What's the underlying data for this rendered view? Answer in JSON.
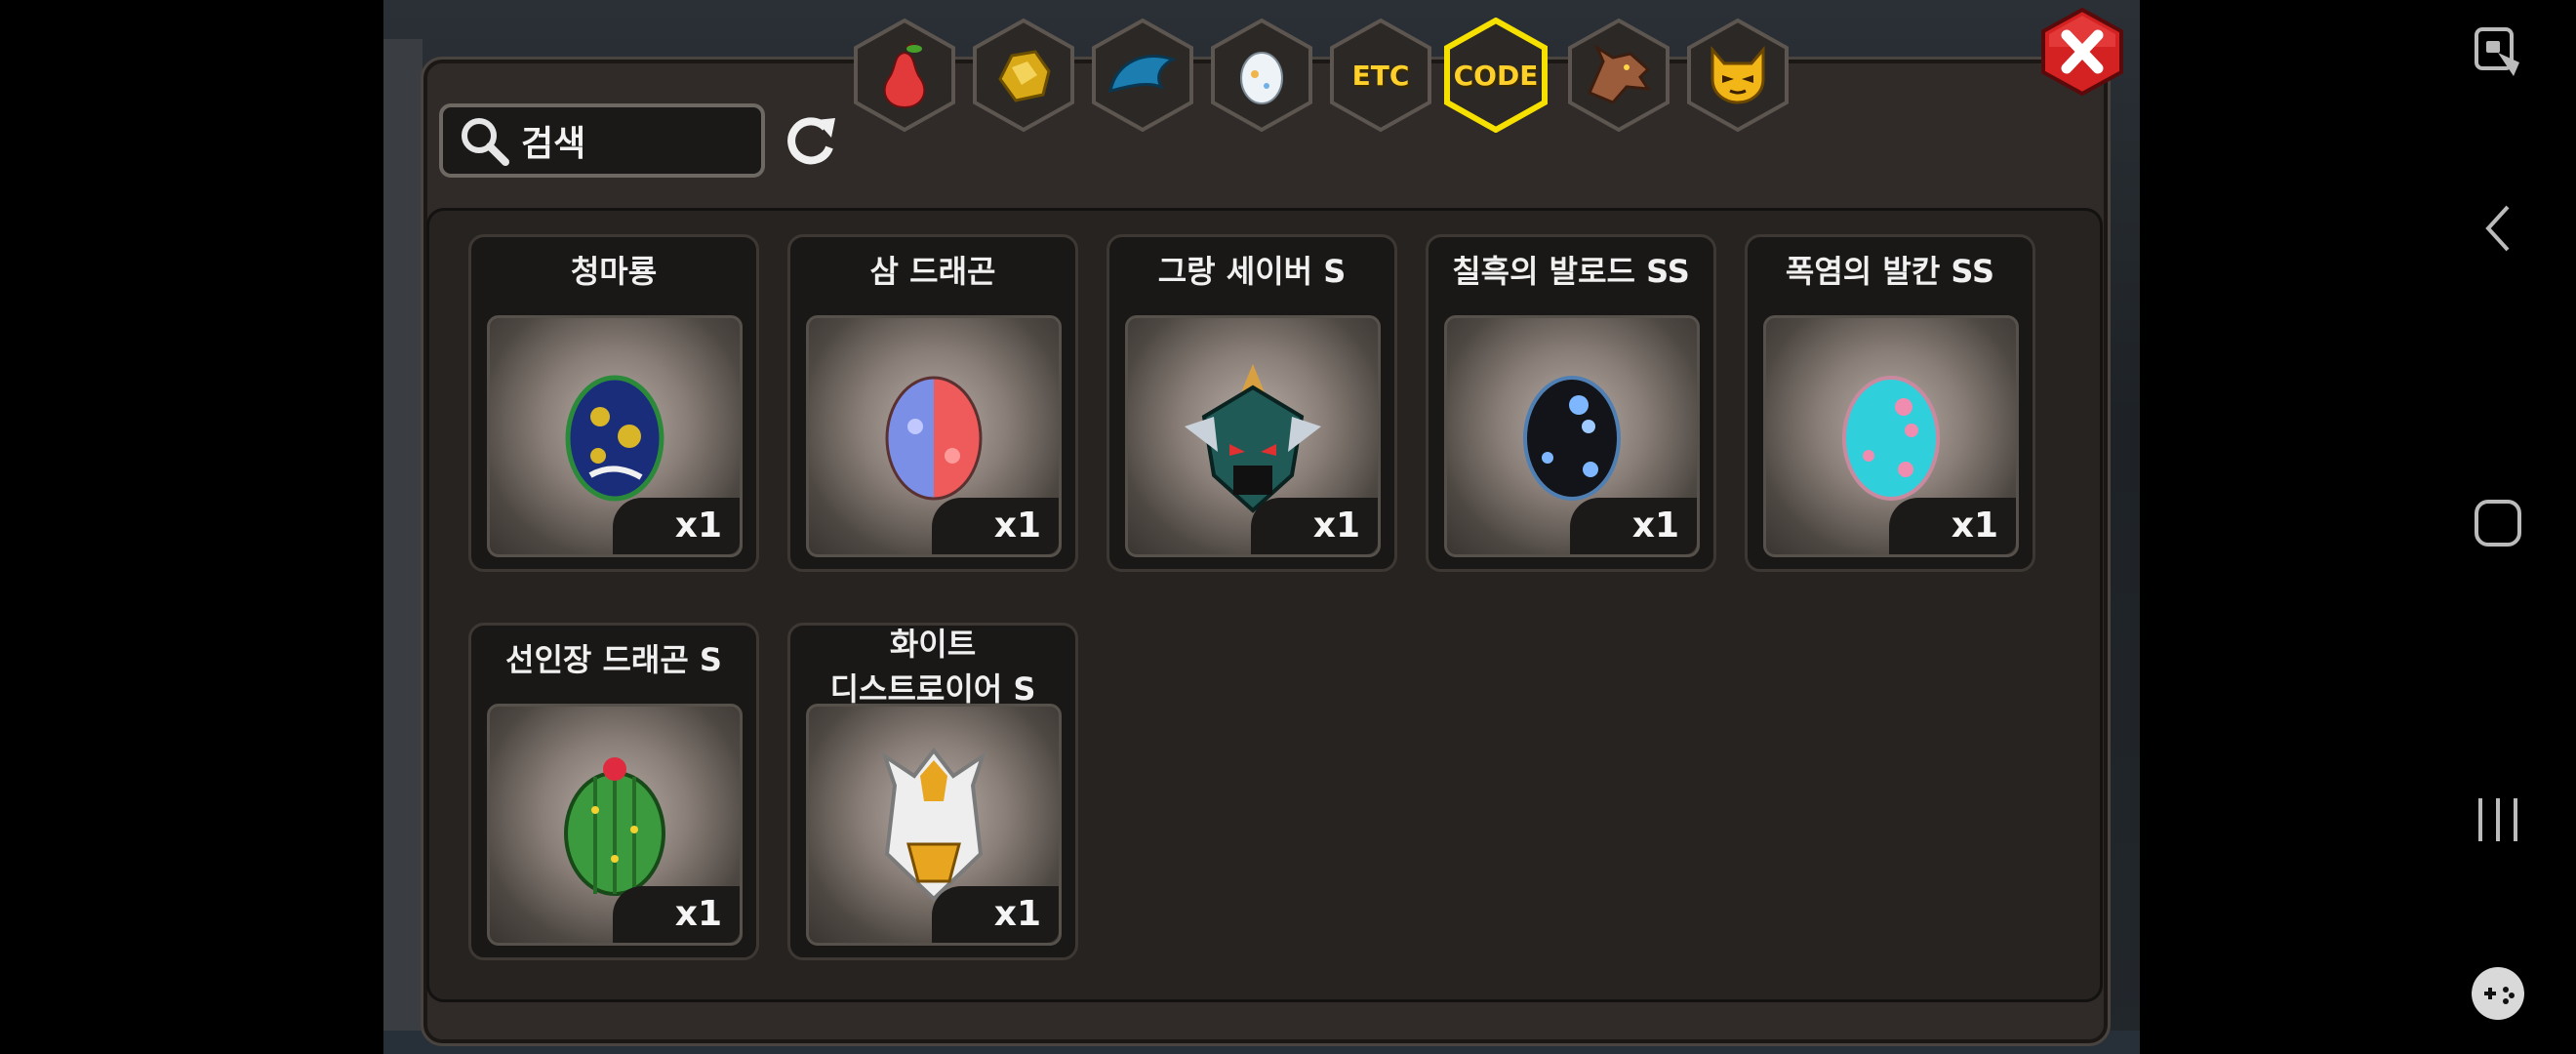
{
  "search": {
    "label": "검색"
  },
  "tabs": [
    {
      "id": "fruit",
      "icon": "pear-icon",
      "selected": false
    },
    {
      "id": "ore",
      "icon": "gold-nugget-icon",
      "selected": false
    },
    {
      "id": "monster",
      "icon": "blue-creature-icon",
      "selected": false
    },
    {
      "id": "egg",
      "icon": "egg-icon",
      "selected": false
    },
    {
      "id": "etc",
      "label": "ETC",
      "selected": false
    },
    {
      "id": "code",
      "label": "CODE",
      "selected": true
    },
    {
      "id": "dragon",
      "icon": "dragon-head-icon",
      "selected": false
    },
    {
      "id": "mask",
      "icon": "devil-mask-icon",
      "selected": false
    }
  ],
  "items": [
    {
      "name": "청마룡",
      "qty": "x1",
      "icon": "blue-gold-egg-icon"
    },
    {
      "name": "삼 드래곤",
      "qty": "x1",
      "icon": "blue-red-egg-icon"
    },
    {
      "name": "그랑 세이버 S",
      "qty": "x1",
      "icon": "green-armor-helmet-icon"
    },
    {
      "name": "칠흑의 발로드 SS",
      "qty": "x1",
      "icon": "black-blue-egg-icon"
    },
    {
      "name": "폭염의 발칸 SS",
      "qty": "x1",
      "icon": "cyan-pink-egg-icon"
    },
    {
      "name": "선인장 드래곤 S",
      "qty": "x1",
      "icon": "cactus-egg-icon"
    },
    {
      "name": "화이트 디스트로이어 S",
      "name_line1": "화이트",
      "name_line2": "디스트로이어 S",
      "qty": "x1",
      "icon": "white-gold-armor-icon"
    }
  ],
  "colors": {
    "selected_tab_border": "#f5e000",
    "close_red": "#d42121",
    "panel_bg": "#302b28"
  }
}
